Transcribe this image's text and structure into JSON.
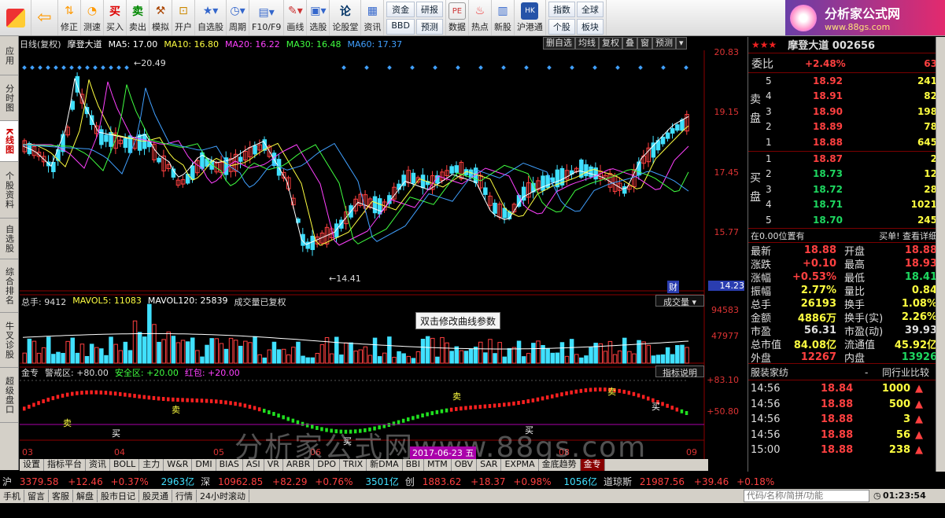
{
  "toolbar": {
    "items": [
      {
        "label": "修正",
        "icon": "up-down-arrows-icon"
      },
      {
        "label": "测速",
        "icon": "stopwatch-icon"
      },
      {
        "label": "买入",
        "icon": "buy-icon"
      },
      {
        "label": "卖出",
        "icon": "sell-icon"
      },
      {
        "label": "模拟",
        "icon": "hammer-icon"
      },
      {
        "label": "开户",
        "icon": "lock-icon"
      },
      {
        "label": "自选股",
        "icon": "star-list-icon"
      },
      {
        "label": "周期",
        "icon": "clock-icon"
      },
      {
        "label": "F10/F9",
        "icon": "report-icon"
      },
      {
        "label": "画线",
        "icon": "pen-icon"
      },
      {
        "label": "选股",
        "icon": "screen-icon"
      },
      {
        "label": "论股堂",
        "icon": "forum-icon"
      },
      {
        "label": "资讯",
        "icon": "news-icon"
      }
    ],
    "grid_buttons": [
      "资金",
      "研报",
      "BBD",
      "预测"
    ],
    "grid_buttons2": [
      "指数",
      "全球",
      "个股",
      "板块"
    ],
    "small_items": [
      {
        "label": "数据",
        "icon": "pe-icon"
      },
      {
        "label": "热点",
        "icon": "hot-icon"
      },
      {
        "label": "新股",
        "icon": "new-stock-icon"
      },
      {
        "label": "沪港通",
        "icon": "hk-connect-icon"
      }
    ],
    "brand_title": "分析家公式网",
    "brand_url": "www.88gs.com"
  },
  "left_tabs": [
    "应用",
    "分时图",
    "K线图",
    "个股资料",
    "自选股",
    "综合排名",
    "牛叉诊股",
    "超级盘口"
  ],
  "chart": {
    "title": "日线(复权)",
    "stock_name": "摩登大道",
    "ma": [
      {
        "label": "MA5: 17.00",
        "color": "#ffffff"
      },
      {
        "label": "MA10: 16.80",
        "color": "#ffff40"
      },
      {
        "label": "MA20: 16.22",
        "color": "#ff40ff"
      },
      {
        "label": "MA30: 16.48",
        "color": "#40ff40"
      },
      {
        "label": "MA60: 17.37",
        "color": "#40a0ff"
      }
    ],
    "buttons": [
      "删自选",
      "均线",
      "复权",
      "叠",
      "窗",
      "预测"
    ],
    "price_axis": [
      "20.83",
      "19.15",
      "17.45",
      "15.77",
      "14.23"
    ],
    "high_mark": "20.49",
    "low_mark": "14.41",
    "finance_mark": "财",
    "x_labels": [
      "03",
      "04",
      "05",
      "06",
      "07",
      "08",
      "09"
    ],
    "date_badge": "2017-06-23 五"
  },
  "volume": {
    "total": "总手: 9412",
    "mavol5": "MAVOL5: 11083",
    "mavol120": "MAVOL120: 25839",
    "note": "成交量已复权",
    "axis": [
      "94583",
      "47977"
    ],
    "selector": "成交量"
  },
  "indicator": {
    "name": "金专",
    "warn": "警戒区: +80.00",
    "safe": "安全区: +20.00",
    "redpack": "红包: +20.00",
    "axis": [
      "+83.10",
      "+50.80"
    ],
    "explain_btn": "指标说明",
    "buy_labels": [
      "买",
      "买",
      "买",
      "买"
    ],
    "sell_labels": [
      "卖",
      "卖",
      "卖",
      "卖"
    ]
  },
  "tooltip": "双击修改曲线参数",
  "watermark": "分析家公式网www.88gs.com",
  "bottom_tabs": [
    "设置",
    "指标平台",
    "资讯",
    "BOLL",
    "主力",
    "W&R",
    "DMI",
    "BIAS",
    "ASI",
    "VR",
    "ARBR",
    "DPO",
    "TRIX",
    "新DMA",
    "BBI",
    "MTM",
    "OBV",
    "SAR",
    "EXPMA",
    "金底趋势",
    "金专"
  ],
  "right_tabs": [
    "细",
    "分",
    "筹",
    "焰",
    "指",
    "财"
  ],
  "quote": {
    "header_name": "摩登大道 002656",
    "weibi_label": "委比",
    "weibi_value": "+2.48%",
    "weibi_diff": "63",
    "sell_label": "卖盘",
    "buy_label": "买盘",
    "asks": [
      {
        "level": "5",
        "price": "18.92",
        "vol": "241"
      },
      {
        "level": "4",
        "price": "18.91",
        "vol": "82"
      },
      {
        "level": "3",
        "price": "18.90",
        "vol": "198"
      },
      {
        "level": "2",
        "price": "18.89",
        "vol": "78"
      },
      {
        "level": "1",
        "price": "18.88",
        "vol": "645"
      }
    ],
    "bids": [
      {
        "level": "1",
        "price": "18.87",
        "vol": "2"
      },
      {
        "level": "2",
        "price": "18.73",
        "vol": "12"
      },
      {
        "level": "3",
        "price": "18.72",
        "vol": "28"
      },
      {
        "level": "4",
        "price": "18.71",
        "vol": "1021"
      },
      {
        "level": "5",
        "price": "18.70",
        "vol": "245"
      }
    ],
    "position_label": "在0.00位置有",
    "position_links": "买单! 查看详细",
    "stats": [
      {
        "l1": "最新",
        "v1": "18.88",
        "c1": "red",
        "l2": "开盘",
        "v2": "18.88",
        "c2": "red"
      },
      {
        "l1": "涨跌",
        "v1": "+0.10",
        "c1": "red",
        "l2": "最高",
        "v2": "18.93",
        "c2": "red"
      },
      {
        "l1": "涨幅",
        "v1": "+0.53%",
        "c1": "red",
        "l2": "最低",
        "v2": "18.41",
        "c2": "green"
      },
      {
        "l1": "振幅",
        "v1": "2.77%",
        "c1": "yellow",
        "l2": "量比",
        "v2": "0.84",
        "c2": "yellow"
      },
      {
        "l1": "总手",
        "v1": "26193",
        "c1": "yellow",
        "l2": "换手",
        "v2": "1.08%",
        "c2": "yellow"
      },
      {
        "l1": "金额",
        "v1": "4886万",
        "c1": "yellow",
        "l2": "换手(实)",
        "v2": "2.26%",
        "c2": "yellow"
      },
      {
        "l1": "市盈",
        "v1": "56.31",
        "c1": "white",
        "l2": "市盈(动)",
        "v2": "39.93",
        "c2": "white"
      },
      {
        "l1": "总市值",
        "v1": "84.08亿",
        "c1": "yellow",
        "l2": "流通值",
        "v2": "45.92亿",
        "c2": "yellow"
      },
      {
        "l1": "外盘",
        "v1": "12267",
        "c1": "red",
        "l2": "内盘",
        "v2": "13926",
        "c2": "green"
      }
    ],
    "seat_label": "服装家纺",
    "seat_right": "同行业比较",
    "ticks": [
      {
        "time": "14:56",
        "price": "18.84",
        "vol": "1000",
        "dir": "up"
      },
      {
        "time": "14:56",
        "price": "18.88",
        "vol": "500",
        "dir": "up"
      },
      {
        "time": "14:56",
        "price": "18.88",
        "vol": "3",
        "dir": "up"
      },
      {
        "time": "14:56",
        "price": "18.88",
        "vol": "56",
        "dir": "up"
      },
      {
        "time": "15:00",
        "price": "18.88",
        "vol": "238",
        "dir": "up"
      }
    ]
  },
  "index_bar": [
    {
      "name": "沪",
      "value": "3379.58",
      "change": "+12.46",
      "pct": "+0.37%",
      "amount": "2963亿"
    },
    {
      "name": "深",
      "value": "10962.85",
      "change": "+82.29",
      "pct": "+0.76%",
      "amount": "3501亿"
    },
    {
      "name": "创",
      "value": "1883.62",
      "change": "+18.37",
      "pct": "+0.98%",
      "amount": "1056亿"
    },
    {
      "name": "道琼斯",
      "value": "21987.56",
      "change": "+39.46",
      "pct": "+0.18%",
      "amount": ""
    }
  ],
  "status_bar": {
    "items": [
      "手机",
      "留言",
      "客服",
      "解盘",
      "股市日记",
      "股灵通",
      "行情",
      "24小时滚动"
    ],
    "search_placeholder": "代码/名称/简拼/功能",
    "time": "01:23:54"
  }
}
